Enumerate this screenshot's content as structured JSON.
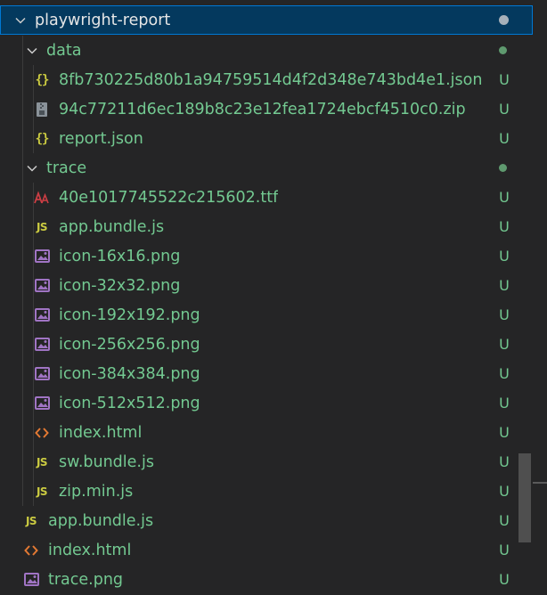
{
  "explorer": {
    "root": {
      "label": "playwright-report"
    },
    "data_folder": {
      "label": "data"
    },
    "data_files": [
      {
        "label": "8fb730225d80b1a94759514d4f2d348e743bd4e1.json",
        "status": "U",
        "icon": "json-braces-icon"
      },
      {
        "label": "94c77211d6ec189b8c23e12fea1724ebcf4510c0.zip",
        "status": "U",
        "icon": "zip-icon"
      },
      {
        "label": "report.json",
        "status": "U",
        "icon": "json-braces-icon"
      }
    ],
    "trace_folder": {
      "label": "trace"
    },
    "trace_files": [
      {
        "label": "40e1017745522c215602.ttf",
        "status": "U",
        "icon": "font-icon"
      },
      {
        "label": "app.bundle.js",
        "status": "U",
        "icon": "js-icon"
      },
      {
        "label": "icon-16x16.png",
        "status": "U",
        "icon": "image-icon"
      },
      {
        "label": "icon-32x32.png",
        "status": "U",
        "icon": "image-icon"
      },
      {
        "label": "icon-192x192.png",
        "status": "U",
        "icon": "image-icon"
      },
      {
        "label": "icon-256x256.png",
        "status": "U",
        "icon": "image-icon"
      },
      {
        "label": "icon-384x384.png",
        "status": "U",
        "icon": "image-icon"
      },
      {
        "label": "icon-512x512.png",
        "status": "U",
        "icon": "image-icon"
      },
      {
        "label": "index.html",
        "status": "U",
        "icon": "html-icon"
      },
      {
        "label": "sw.bundle.js",
        "status": "U",
        "icon": "js-icon"
      },
      {
        "label": "zip.min.js",
        "status": "U",
        "icon": "js-icon"
      }
    ],
    "root_files": [
      {
        "label": "app.bundle.js",
        "status": "U",
        "icon": "js-icon"
      },
      {
        "label": "index.html",
        "status": "U",
        "icon": "html-icon"
      },
      {
        "label": "trace.png",
        "status": "U",
        "icon": "image-icon"
      }
    ]
  },
  "colors": {
    "untracked": "#73c991",
    "selection": "#04395e",
    "selection_border": "#0078d4",
    "js": "#cbcb41",
    "html": "#e37933",
    "image": "#a074c4",
    "font": "#cc3e44"
  }
}
